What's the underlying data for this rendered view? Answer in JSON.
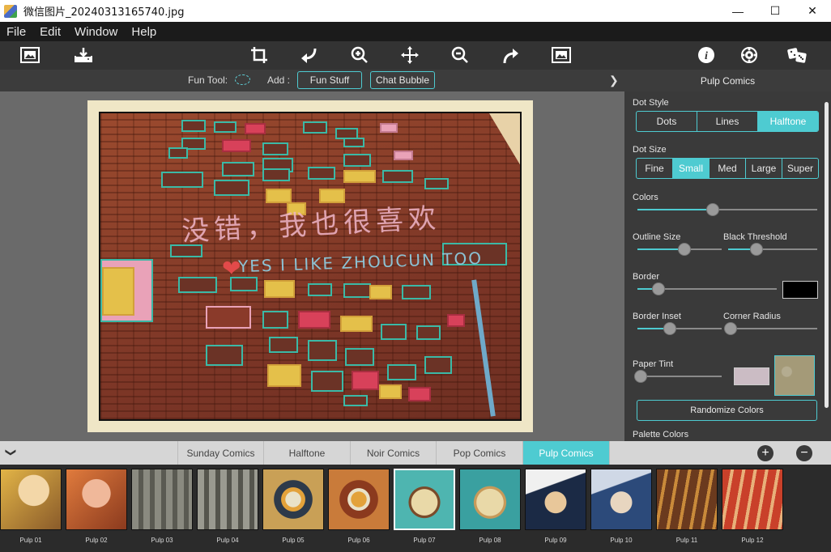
{
  "window": {
    "title": "微信图片_20240313165740.jpg",
    "minimize": "—",
    "maximize": "☐",
    "close": "✕"
  },
  "menu": [
    "File",
    "Edit",
    "Window",
    "Help"
  ],
  "subbar": {
    "fun_tool_label": "Fun Tool:",
    "add_label": "Add :",
    "fun_stuff": "Fun Stuff",
    "chat_bubble": "Chat Bubble"
  },
  "panel": {
    "title": "Pulp Comics",
    "dot_style_label": "Dot Style",
    "dot_style_options": [
      "Dots",
      "Lines",
      "Halftone"
    ],
    "dot_style_selected": "Halftone",
    "dot_size_label": "Dot Size",
    "dot_size_options": [
      "Fine",
      "Small",
      "Med",
      "Large",
      "Super"
    ],
    "dot_size_selected": "Small",
    "colors_label": "Colors",
    "colors_value": 0.42,
    "outline_size_label": "Outline Size",
    "outline_size_value": 0.56,
    "black_threshold_label": "Black Threshold",
    "black_threshold_value": 0.32,
    "border_label": "Border",
    "border_value": 0.15,
    "border_color": "#000000",
    "border_inset_label": "Border Inset",
    "border_inset_value": 0.38,
    "corner_radius_label": "Corner Radius",
    "corner_radius_value": 0.03,
    "paper_tint_label": "Paper Tint",
    "paper_tint_value": 0.04,
    "paper_tint_color": "#cbbcc4",
    "paper_texture_color": "#a49a78",
    "randomize_button": "Randomize Colors",
    "palette_colors_label": "Palette Colors"
  },
  "tabs": [
    "Sunday Comics",
    "Halftone",
    "Noir Comics",
    "Pop Comics",
    "Pulp Comics"
  ],
  "tabs_selected": "Pulp Comics",
  "thumbnails": [
    "Pulp 01",
    "Pulp 02",
    "Pulp 03",
    "Pulp 04",
    "Pulp 05",
    "Pulp 06",
    "Pulp 07",
    "Pulp 08",
    "Pulp 09",
    "Pulp 10",
    "Pulp 11",
    "Pulp 12"
  ],
  "thumbnails_selected": "Pulp 07",
  "accent_color": "#4ecbd1",
  "toolbar_icons": [
    "image-icon",
    "save-icon",
    "crop-icon",
    "rotate-left-icon",
    "zoom-in-icon",
    "move-icon",
    "zoom-out-icon",
    "rotate-right-icon",
    "fit-image-icon",
    "info-icon",
    "settings-icon",
    "random-dice-icon"
  ]
}
